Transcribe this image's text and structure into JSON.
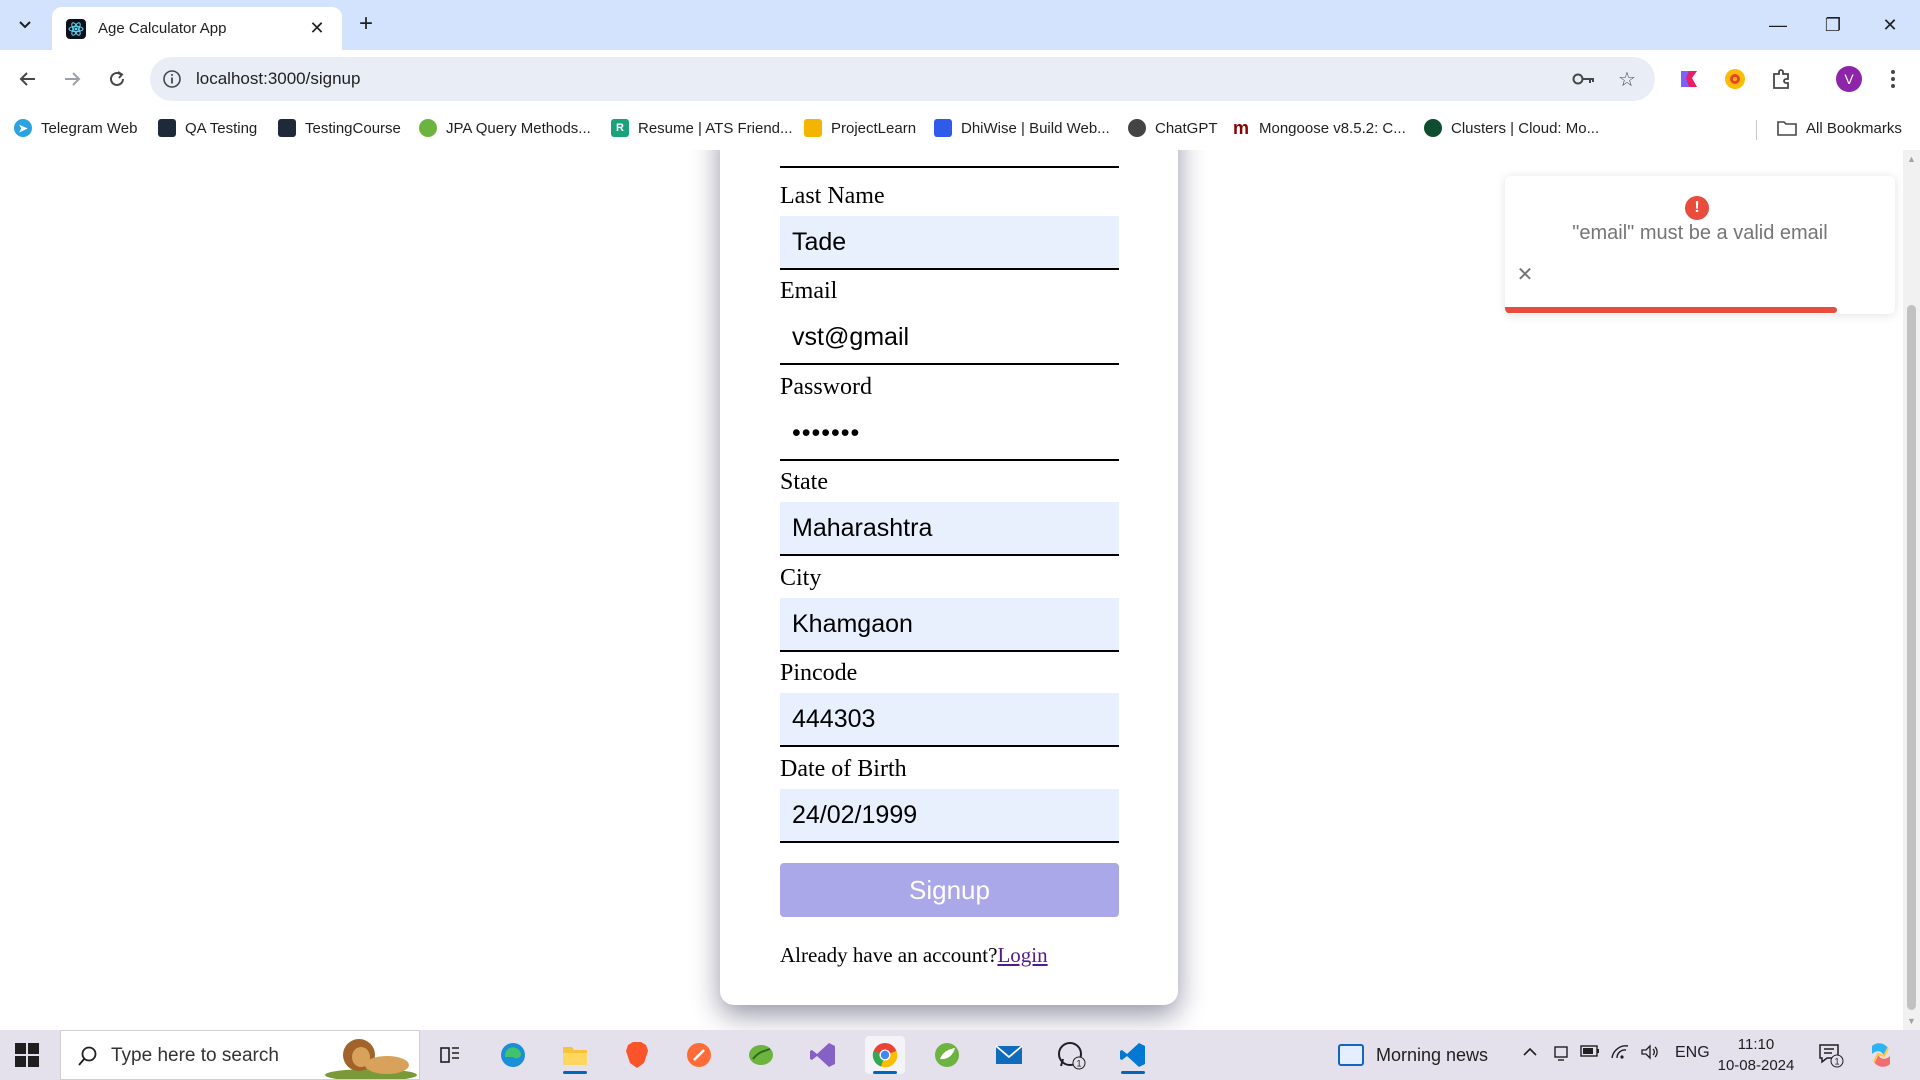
{
  "browser": {
    "tab_title": "Age Calculator App",
    "tab_close": "✕",
    "new_tab": "+",
    "url": "localhost:3000/signup",
    "profile_initial": "V",
    "bookmarks": [
      {
        "label": "Telegram Web",
        "color": "#2aa3e0"
      },
      {
        "label": "QA Testing",
        "color": "#1e2a3a"
      },
      {
        "label": "TestingCourse",
        "color": "#1e2a3a"
      },
      {
        "label": "JPA Query Methods...",
        "color": "#6db33f"
      },
      {
        "label": "Resume | ATS Friend...",
        "color": "#1aa37a"
      },
      {
        "label": "ProjectLearn",
        "color": "#f5b400"
      },
      {
        "label": "DhiWise | Build Web...",
        "color": "#2f5bea"
      },
      {
        "label": "ChatGPT",
        "color": "#444444"
      },
      {
        "label": "Mongoose v8.5.2: C...",
        "color": "#880000"
      },
      {
        "label": "Clusters | Cloud: Mo...",
        "color": "#0e4d2f"
      }
    ],
    "all_bookmarks": "All Bookmarks"
  },
  "form": {
    "fields": [
      {
        "label": "Last Name",
        "value": "Tade"
      },
      {
        "label": "Email",
        "value": "vst@gmail"
      },
      {
        "label": "Password",
        "value": "•••••••"
      },
      {
        "label": "State",
        "value": "Maharashtra"
      },
      {
        "label": "City",
        "value": "Khamgaon"
      },
      {
        "label": "Pincode",
        "value": "444303"
      },
      {
        "label": "Date of Birth",
        "value": "24/02/1999"
      }
    ],
    "signup_label": "Signup",
    "account_prompt": "Already have an account?",
    "login_link": "Login"
  },
  "toast": {
    "icon": "!",
    "message": "\"email\" must be a valid email",
    "close": "✕",
    "progress": 0.85,
    "color": "#e74c3c"
  },
  "taskbar": {
    "search_placeholder": "Type here to search",
    "news": "Morning news",
    "language": "ENG",
    "time": "11:10",
    "date": "10-08-2024",
    "whatsapp_badge": "1",
    "notification_badge": "1"
  }
}
